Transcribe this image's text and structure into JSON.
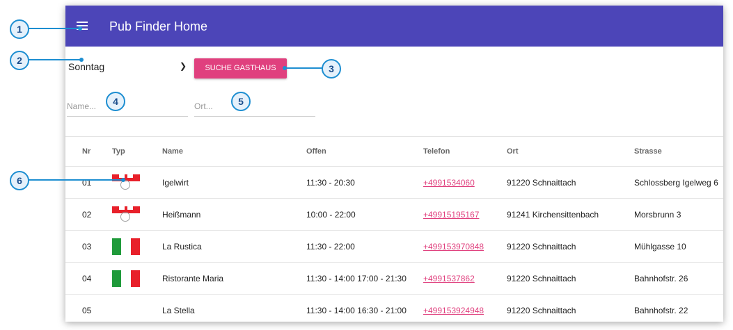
{
  "header": {
    "title": "Pub Finder Home"
  },
  "filters": {
    "day_selected": "Sonntag",
    "search_button": "SUCHE GASTHAUS",
    "name_placeholder": "Name...",
    "ort_placeholder": "Ort..."
  },
  "table": {
    "columns": [
      "Nr",
      "Typ",
      "Name",
      "Offen",
      "Telefon",
      "Ort",
      "Strasse"
    ],
    "rows": [
      {
        "nr": "01",
        "typ": "franconian-flag",
        "name": "Igelwirt",
        "offen": "11:30 - 20:30",
        "telefon": "+4991534060",
        "ort": "91220 Schnaittach",
        "strasse": "Schlossberg Igelweg 6"
      },
      {
        "nr": "02",
        "typ": "franconian-flag",
        "name": "Heißmann",
        "offen": "10:00 - 22:00",
        "telefon": "+49915195167",
        "ort": "91241 Kirchensittenbach",
        "strasse": "Morsbrunn 3"
      },
      {
        "nr": "03",
        "typ": "italian-flag",
        "name": "La Rustica",
        "offen": "11:30 - 22:00",
        "telefon": "+499153970848",
        "ort": "91220 Schnaittach",
        "strasse": "Mühlgasse 10"
      },
      {
        "nr": "04",
        "typ": "italian-flag",
        "name": "Ristorante Maria",
        "offen": "11:30 - 14:00 17:00 - 21:30",
        "telefon": "+4991537862",
        "ort": "91220 Schnaittach",
        "strasse": "Bahnhofstr. 26"
      },
      {
        "nr": "05",
        "typ": "",
        "name": "La Stella",
        "offen": "11:30 - 14:00 16:30 - 21:00",
        "telefon": "+499153924948",
        "ort": "91220 Schnaittach",
        "strasse": "Bahnhofstr. 22"
      }
    ]
  },
  "callouts": [
    "1",
    "2",
    "3",
    "4",
    "5",
    "6"
  ],
  "colors": {
    "toolbar": "#4c45b8",
    "accent": "#e0407e",
    "callout": "#1d8ed1",
    "flag_red": "#e8202a",
    "flag_green": "#1f9a3a"
  }
}
